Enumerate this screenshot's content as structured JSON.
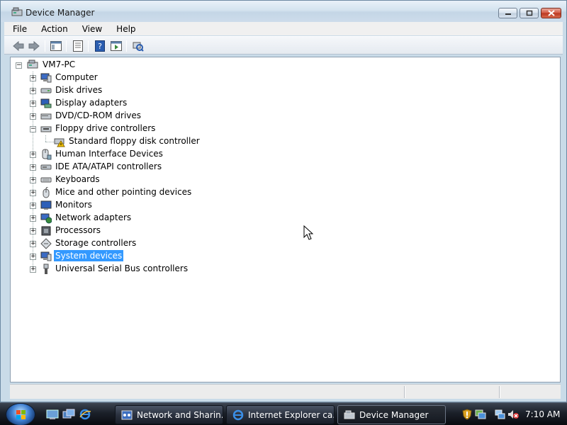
{
  "window": {
    "title": "Device Manager",
    "icon": "device-manager-icon"
  },
  "menu": [
    "File",
    "Action",
    "View",
    "Help"
  ],
  "toolbar": {
    "buttons": [
      "back-arrow-icon",
      "forward-arrow-icon",
      "show-hide-console-tree-icon",
      "properties-icon",
      "help-icon",
      "run-icon",
      "scan-hardware-icon"
    ]
  },
  "tree": {
    "root": "VM7-PC",
    "categories": [
      {
        "label": "Computer",
        "icon": "computer-icon",
        "expanded": false
      },
      {
        "label": "Disk drives",
        "icon": "disk-drive-icon",
        "expanded": false
      },
      {
        "label": "Display adapters",
        "icon": "display-adapter-icon",
        "expanded": false
      },
      {
        "label": "DVD/CD-ROM drives",
        "icon": "dvd-drive-icon",
        "expanded": false
      },
      {
        "label": "Floppy drive controllers",
        "icon": "floppy-controller-icon",
        "expanded": true
      },
      {
        "label": "Standard floppy disk controller",
        "icon": "warning-device-icon",
        "child": true
      },
      {
        "label": "Human Interface Devices",
        "icon": "hid-icon",
        "expanded": false
      },
      {
        "label": "IDE ATA/ATAPI controllers",
        "icon": "ide-controller-icon",
        "expanded": false
      },
      {
        "label": "Keyboards",
        "icon": "keyboard-icon",
        "expanded": false
      },
      {
        "label": "Mice and other pointing devices",
        "icon": "mouse-icon",
        "expanded": false
      },
      {
        "label": "Monitors",
        "icon": "monitor-icon",
        "expanded": false
      },
      {
        "label": "Network adapters",
        "icon": "network-adapter-icon",
        "expanded": false
      },
      {
        "label": "Processors",
        "icon": "processor-icon",
        "expanded": false
      },
      {
        "label": "Storage controllers",
        "icon": "storage-controller-icon",
        "expanded": false
      },
      {
        "label": "System devices",
        "icon": "system-devices-icon",
        "expanded": false,
        "selected": true
      },
      {
        "label": "Universal Serial Bus controllers",
        "icon": "usb-icon",
        "expanded": false
      }
    ]
  },
  "taskbar": {
    "tasks": [
      {
        "label": "Network and Sharin...",
        "icon": "network-center-icon"
      },
      {
        "label": "Internet Explorer ca...",
        "icon": "internet-explorer-icon"
      },
      {
        "label": "Device Manager",
        "icon": "device-manager-icon",
        "active": true
      }
    ],
    "clock": "7:10 AM"
  },
  "colors": {
    "selection": "#3399ff",
    "window_frame": "#c9dbe8",
    "close_button": "#c7452c"
  }
}
